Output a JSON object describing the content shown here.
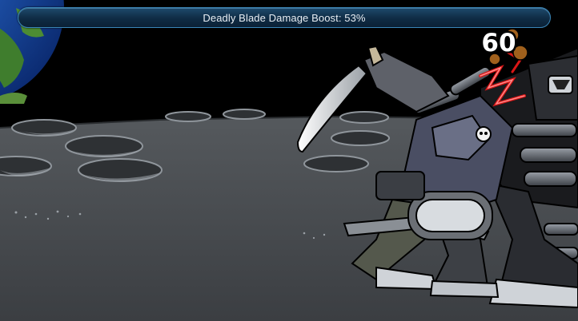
{
  "hud": {
    "buff_text": "Deadly Blade Damage Boost: 53%",
    "damage_number": "60"
  },
  "scene": {
    "location": "moon surface",
    "characters": [
      "player-mech-warrior",
      "enemy-mech-robot"
    ],
    "weapon": "machete",
    "colors": {
      "space": "#000000",
      "lunar_surface": "#4d5155",
      "buff_bar": "#163a58",
      "buff_border": "#3a86b8",
      "hit_spark": "#e01818"
    }
  }
}
